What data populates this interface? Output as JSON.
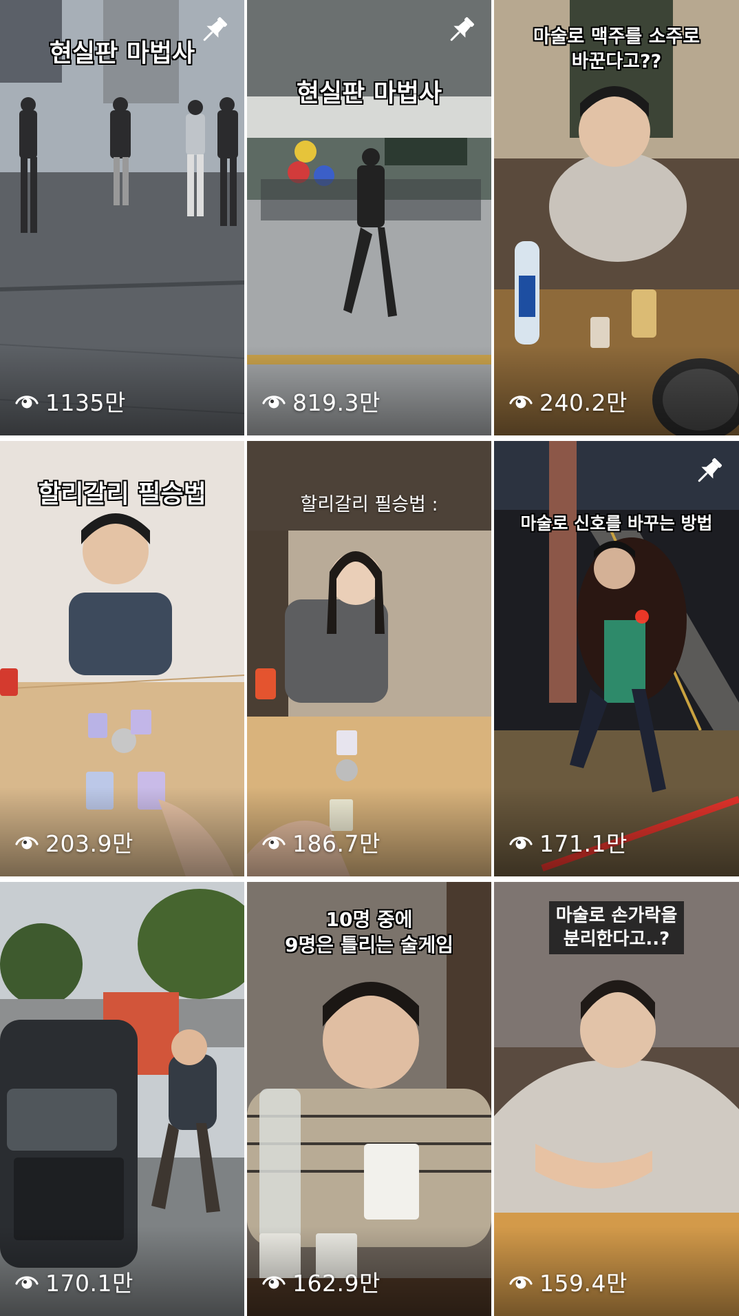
{
  "videos": [
    {
      "caption": "현실판 마법사",
      "views": "1135만",
      "pinned": true
    },
    {
      "caption": "현실판 마법사",
      "views": "819.3만",
      "pinned": true
    },
    {
      "caption": "마술로 맥주를 소주로\n바꾼다고??",
      "views": "240.2만",
      "pinned": false
    },
    {
      "caption": "할리갈리 필승법",
      "views": "203.9만",
      "pinned": false
    },
    {
      "caption": "할리갈리 필승법 :",
      "views": "186.7만",
      "pinned": false
    },
    {
      "caption": "마술로 신호를 바꾸는 방법",
      "views": "171.1만",
      "pinned": true
    },
    {
      "caption": "",
      "views": "170.1만",
      "pinned": false
    },
    {
      "caption": "10명 중에\n9명은 틀리는 술게임",
      "views": "162.9만",
      "pinned": false
    },
    {
      "caption": "마술로 손가락을\n분리한다고..?",
      "views": "159.4만",
      "pinned": false
    }
  ],
  "icons": {
    "views": "eye-icon",
    "pinned": "pin-icon"
  },
  "colors": {
    "overlay_text": "#ffffff",
    "background": "#ffffff"
  }
}
